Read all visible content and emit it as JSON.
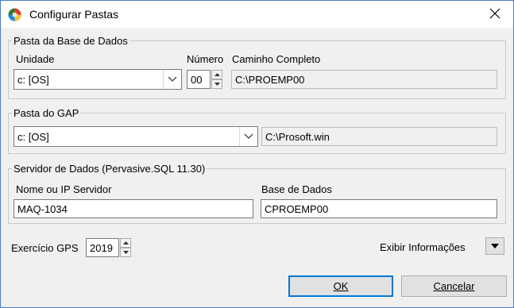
{
  "window": {
    "title": "Configurar Pastas",
    "icon": "app-globe-icon",
    "close_icon": "close-icon"
  },
  "db_group": {
    "legend": "Pasta da Base de Dados",
    "unidade_label": "Unidade",
    "unidade_value": "c: [OS]",
    "numero_label": "Número",
    "numero_value": "00",
    "caminho_label": "Caminho Completo",
    "caminho_value": "C:\\PROEMP00"
  },
  "gap_group": {
    "legend": "Pasta do GAP",
    "unidade_value": "c: [OS]",
    "path_value": "C:\\Prosoft.win"
  },
  "server_group": {
    "legend": "Servidor de Dados (Pervasive.SQL 11.30)",
    "server_label": "Nome ou IP Servidor",
    "server_value": "MAQ-1034",
    "base_label": "Base de Dados",
    "base_value": "CPROEMP00"
  },
  "exercicio": {
    "label": "Exercício GPS",
    "value": "2019"
  },
  "exibir": {
    "label": "Exibir Informações"
  },
  "buttons": {
    "ok_label": "OK",
    "cancel_label": "Cancelar"
  },
  "colors": {
    "focus_border": "#0078d7",
    "window_border": "#4a7cc0"
  }
}
